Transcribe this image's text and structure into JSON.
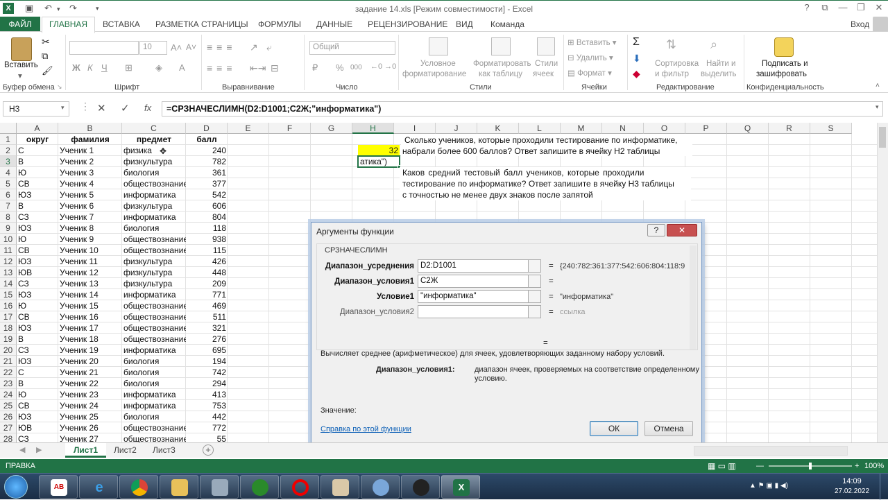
{
  "app": {
    "title": "задание 14.xls [Режим совместимости] - Excel",
    "logo": "X",
    "login": "Вход"
  },
  "tabs": [
    "ФАЙЛ",
    "ГЛАВНАЯ",
    "ВСТАВКА",
    "РАЗМЕТКА СТРАНИЦЫ",
    "ФОРМУЛЫ",
    "ДАННЫЕ",
    "РЕЦЕНЗИРОВАНИЕ",
    "ВИД",
    "Команда"
  ],
  "ribbon": {
    "paste": "Вставить",
    "font_size": "10",
    "number_format": "Общий",
    "bold": "Ж",
    "italic": "К",
    "underline": "Ч",
    "percent": "%",
    "thousands": "000",
    "cond_format_1": "Условное",
    "cond_format_2": "форматирование",
    "format_table_1": "Форматировать",
    "format_table_2": "как таблицу",
    "styles_1": "Стили",
    "styles_2": "ячеек",
    "insert": "Вставить",
    "delete": "Удалить",
    "format": "Формат",
    "sort_1": "Сортировка",
    "sort_2": "и фильтр",
    "find_1": "Найти и",
    "find_2": "выделить",
    "sign_1": "Подписать и",
    "sign_2": "зашифровать",
    "groups": [
      "Буфер обмена",
      "Шрифт",
      "Выравнивание",
      "Число",
      "Стили",
      "Ячейки",
      "Редактирование",
      "Конфиденциальность"
    ]
  },
  "formula_bar": {
    "name_box": "H3",
    "formula": "=СРЗНАЧЕСЛИМН(D2:D1001;C2Ж;\"информатика\")",
    "fx": "fx"
  },
  "columns": [
    "A",
    "B",
    "C",
    "D",
    "E",
    "F",
    "G",
    "H",
    "I",
    "J",
    "K",
    "L",
    "M",
    "N",
    "O",
    "P",
    "Q",
    "R",
    "S"
  ],
  "headers": {
    "a": "округ",
    "b": "фамилия",
    "c": "предмет",
    "d": "балл"
  },
  "rows": [
    [
      "С",
      "Ученик 1",
      "физика",
      "240"
    ],
    [
      "В",
      "Ученик 2",
      "физкультура",
      "782"
    ],
    [
      "Ю",
      "Ученик 3",
      "биология",
      "361"
    ],
    [
      "СВ",
      "Ученик 4",
      "обществознание",
      "377"
    ],
    [
      "ЮЗ",
      "Ученик 5",
      "информатика",
      "542"
    ],
    [
      "В",
      "Ученик 6",
      "физкультура",
      "606"
    ],
    [
      "СЗ",
      "Ученик 7",
      "информатика",
      "804"
    ],
    [
      "ЮЗ",
      "Ученик 8",
      "биология",
      "118"
    ],
    [
      "Ю",
      "Ученик 9",
      "обществознание",
      "938"
    ],
    [
      "СВ",
      "Ученик 10",
      "обществознание",
      "115"
    ],
    [
      "ЮЗ",
      "Ученик 11",
      "физкультура",
      "426"
    ],
    [
      "ЮВ",
      "Ученик 12",
      "физкультура",
      "448"
    ],
    [
      "СЗ",
      "Ученик 13",
      "физкультура",
      "209"
    ],
    [
      "ЮЗ",
      "Ученик 14",
      "информатика",
      "771"
    ],
    [
      "Ю",
      "Ученик 15",
      "обществознание",
      "469"
    ],
    [
      "СВ",
      "Ученик 16",
      "обществознание",
      "511"
    ],
    [
      "ЮЗ",
      "Ученик 17",
      "обществознание",
      "321"
    ],
    [
      "В",
      "Ученик 18",
      "обществознание",
      "276"
    ],
    [
      "СЗ",
      "Ученик 19",
      "информатика",
      "695"
    ],
    [
      "ЮЗ",
      "Ученик 20",
      "биология",
      "194"
    ],
    [
      "С",
      "Ученик 21",
      "биология",
      "742"
    ],
    [
      "В",
      "Ученик 22",
      "биология",
      "294"
    ],
    [
      "Ю",
      "Ученик 23",
      "информатика",
      "413"
    ],
    [
      "СВ",
      "Ученик 24",
      "информатика",
      "753"
    ],
    [
      "ЮЗ",
      "Ученик 25",
      "биология",
      "442"
    ],
    [
      "ЮВ",
      "Ученик 26",
      "обществознание",
      "772"
    ],
    [
      "СЗ",
      "Ученик 27",
      "обществознание",
      "55"
    ]
  ],
  "cells": {
    "h2": "32",
    "h3": "атика\")",
    "q1_line1": "Сколько учеников, которые проходили тестирование по информатике,",
    "q1_line2": "набрали более 600 баллов? Ответ запишите в ячейку H2 таблицы",
    "q2_line1": "Каков средний тестовый балл учеников, которые проходили",
    "q2_line2": "тестирование по информатике? Ответ запишите в ячейку H3 таблицы",
    "q2_line3": "с точностью не менее двух знаков после запятой",
    "h2_fill": "#ffff00"
  },
  "dialog": {
    "title": "Аргументы функции",
    "help_btn": "?",
    "close_btn": "✕",
    "function_name": "СРЗНАЧЕСЛИМН",
    "args": [
      {
        "label": "Диапазон_усреднения",
        "value": "D2:D1001",
        "eq": "=",
        "result": "{240:782:361:377:542:606:804:118:9"
      },
      {
        "label": "Диапазон_условия1",
        "value": "C2Ж",
        "eq": "=",
        "result": ""
      },
      {
        "label": "Условие1",
        "value": "\"информатика\"",
        "eq": "=",
        "result": "\"информатика\""
      },
      {
        "label": "Диапазон_условия2",
        "value": "",
        "eq": "=",
        "result": "ссылка"
      }
    ],
    "extra_eq": "=",
    "description": "Вычисляет среднее (арифметическое) для ячеек, удовлетворяющих заданному набору условий.",
    "arg_name": "Диапазон_условия1:",
    "arg_desc_1": "диапазон ячеек, проверяемых на соответствие определенному",
    "arg_desc_2": "условию.",
    "value_label": "Значение:",
    "help_link": "Справка по этой функции",
    "ok": "ОК",
    "cancel": "Отмена"
  },
  "sheets": [
    "Лист1",
    "Лист2",
    "Лист3"
  ],
  "status": {
    "mode": "ПРАВКА",
    "zoom": "100%"
  },
  "taskbar": {
    "time": "14:09",
    "date": "27.02.2022"
  },
  "colors": {
    "excel_green": "#217346",
    "selected_header": "#e1e1e1",
    "link": "#0b5fb6"
  }
}
